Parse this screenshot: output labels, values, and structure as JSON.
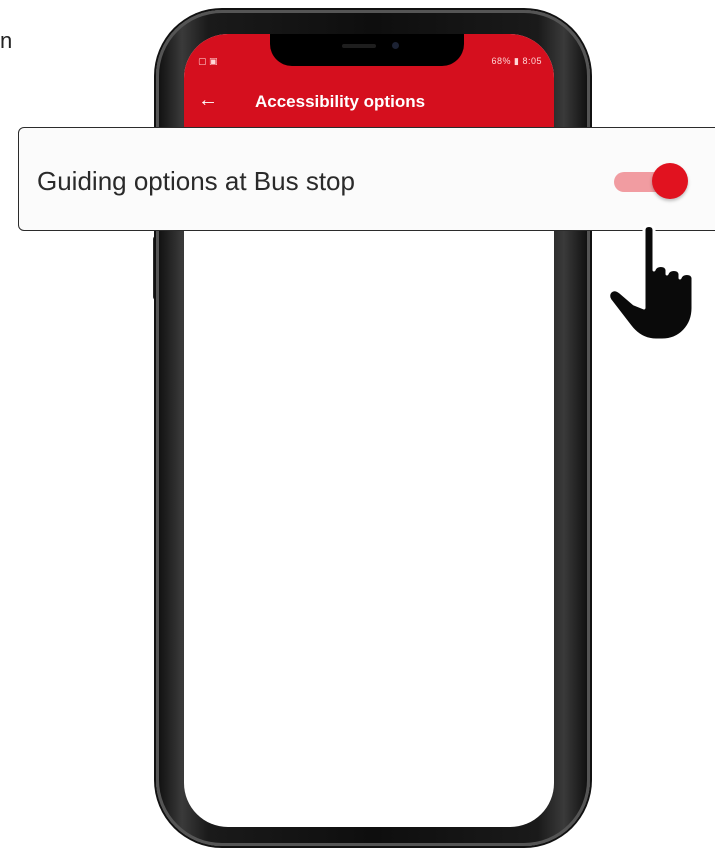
{
  "edge_text": "n",
  "phone": {
    "status_bar": {
      "left_icons": "▢ ▣",
      "right_text": "68% ▮ 8:05"
    },
    "app_bar": {
      "back_icon": "arrow-left-icon",
      "back_glyph": "←",
      "title": "Accessibility options"
    }
  },
  "callout": {
    "label": "Guiding options at Bus stop",
    "toggle_state": "on",
    "colors": {
      "thumb": "#e1121f",
      "track": "#f19ca1"
    }
  },
  "colors": {
    "app_bar": "#d50f1e",
    "screen": "#ffffff"
  }
}
